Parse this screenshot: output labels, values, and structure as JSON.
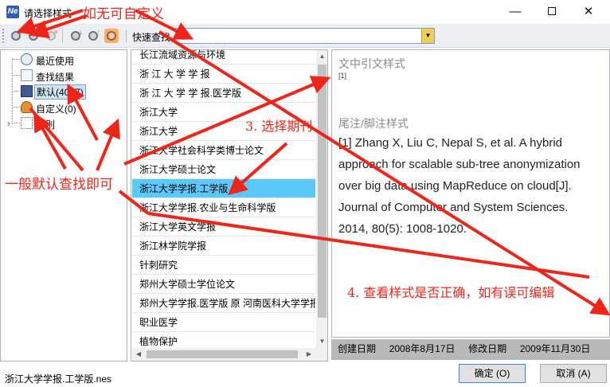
{
  "window": {
    "title": "请选择样式",
    "app_icon": "Ne",
    "min_label": "—",
    "close_label": "✕"
  },
  "toolbar": {
    "icons": [
      "add-style-icon",
      "edit-style-icon",
      "delete-style-icon",
      "import-style-icon",
      "export-style-icon",
      "settings-style-icon"
    ],
    "quick_search_label": "快速查找",
    "quick_search_value": ""
  },
  "tree": {
    "items": [
      {
        "label": "最近使用",
        "icon": "clock-icon"
      },
      {
        "label": "查找结果",
        "icon": "search-result-icon"
      },
      {
        "label": "默认(4017)",
        "icon": "book-icon"
      },
      {
        "label": "自定义(0)",
        "icon": "user-icon"
      },
      {
        "label": "类别",
        "icon": "category-icon",
        "expander": "›"
      }
    ]
  },
  "journal_list": {
    "items": [
      "长江流域资源与环境",
      "浙 江 大 学 学 报",
      "浙 江 大 学 学 报.医学版",
      "浙江大学",
      "浙江大学",
      "浙江大学社会科学类博士论文",
      "浙江大学硕士论文",
      "浙江大学学报.工学版",
      "浙江大学学报.农业与生命科学版",
      "浙江大学英文学报",
      "浙江林学院学报",
      "针刺研究",
      "郑州大学硕士学位论文",
      "郑州大学学报.医学版 原 河南医科大学学报",
      "职业医学",
      "植物保护"
    ],
    "selected_index": 7
  },
  "preview": {
    "citation_heading": "文中引文样式",
    "citation_sample": "[1]",
    "footnote_heading": "尾注/脚注样式",
    "reference_text": "[1] Zhang X, Liu C, Nepal S, et al. A hybrid approach for scalable sub-tree anonymization over big data using MapReduce on cloud[J]. Journal of Computer and System Sciences. 2014, 80(5): 1008-1020."
  },
  "info_bar": {
    "created_label": "创建日期",
    "created_value": "2008年8月17日",
    "modified_label": "修改日期",
    "modified_value": "2009年11月30日"
  },
  "footer": {
    "selected_file": "浙江大学学报.工学版.nes",
    "ok_label": "确定 (O)",
    "cancel_label": "取消 (A)"
  },
  "annotations": {
    "note_custom": "如无可自定义",
    "note_default": "一般默认查找即可",
    "note_step3": "3. 选择期刊",
    "note_step4": "4. 查看样式是否正确，如有误可编辑"
  },
  "colors": {
    "annotation_red": "#f0251a",
    "selection_blue": "#5bc8fa",
    "dropdown_yellow": "#f0d050"
  }
}
